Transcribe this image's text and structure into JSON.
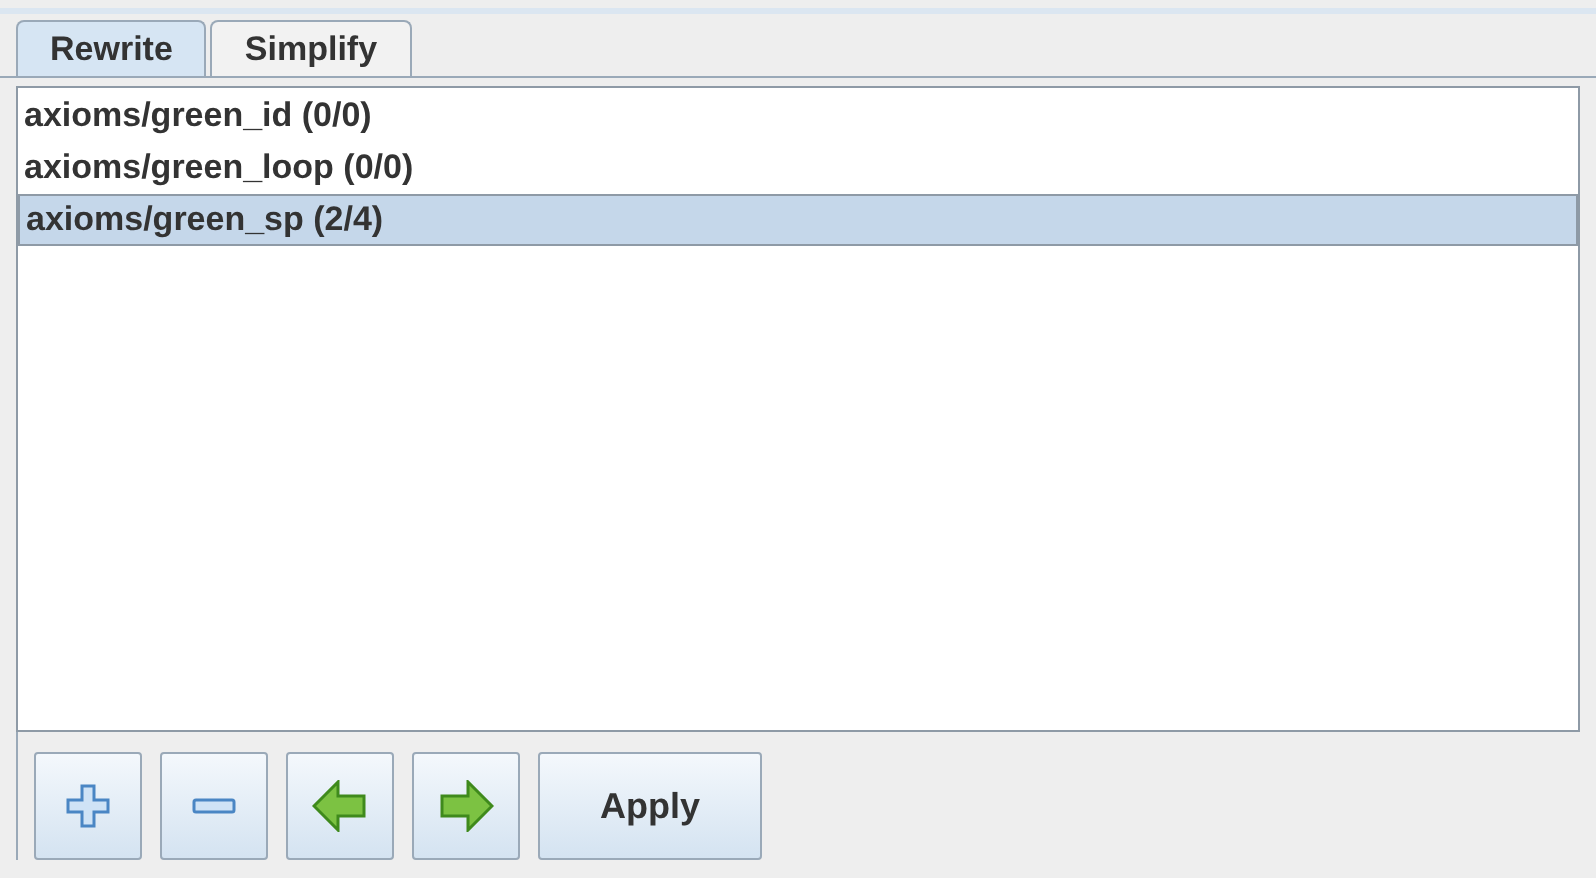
{
  "tabs": [
    {
      "label": "Rewrite",
      "selected": true
    },
    {
      "label": "Simplify",
      "selected": false
    }
  ],
  "rules": [
    {
      "label": "axioms/green_id (0/0)",
      "selected": false
    },
    {
      "label": "axioms/green_loop (0/0)",
      "selected": false
    },
    {
      "label": "axioms/green_sp (2/4)",
      "selected": true
    }
  ],
  "buttons": [
    {
      "kind": "add"
    },
    {
      "kind": "remove"
    },
    {
      "kind": "back"
    },
    {
      "kind": "forward"
    },
    {
      "kind": "text",
      "label": "Apply"
    }
  ]
}
